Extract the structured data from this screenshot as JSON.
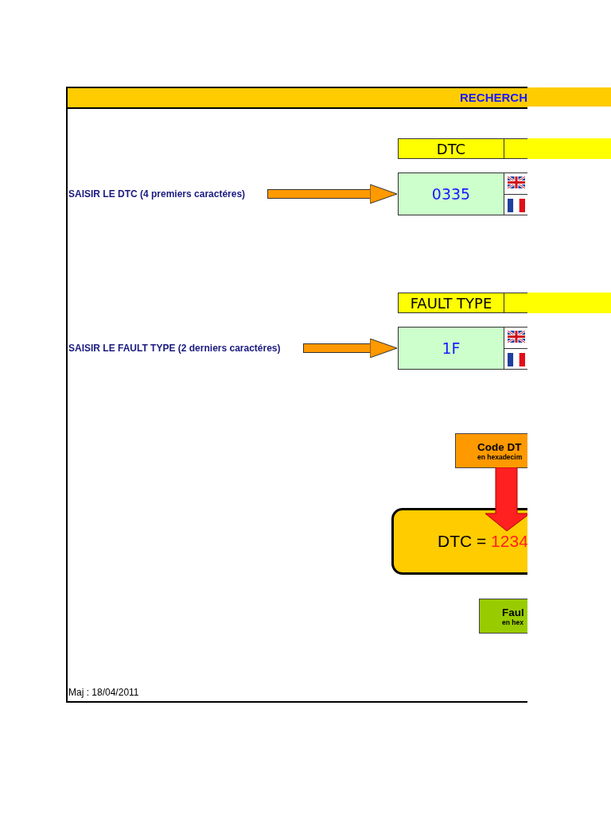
{
  "title": "RECHERCH",
  "sections": [
    {
      "header": "DTC",
      "prompt": "SAISIR LE DTC (4 premiers caractéres)",
      "value": "0335"
    },
    {
      "header": "FAULT TYPE",
      "prompt": "SAISIR LE FAULT TYPE (2 derniers caractéres)",
      "value": "1F"
    }
  ],
  "diagram": {
    "code_box": {
      "title": "Code DT",
      "subtitle": "en hexadecim"
    },
    "result": {
      "label": "DTC = ",
      "code": "1234"
    },
    "fault_box": {
      "title": "Faul",
      "subtitle": "en hex"
    }
  },
  "footer": "Maj : 18/04/2011"
}
